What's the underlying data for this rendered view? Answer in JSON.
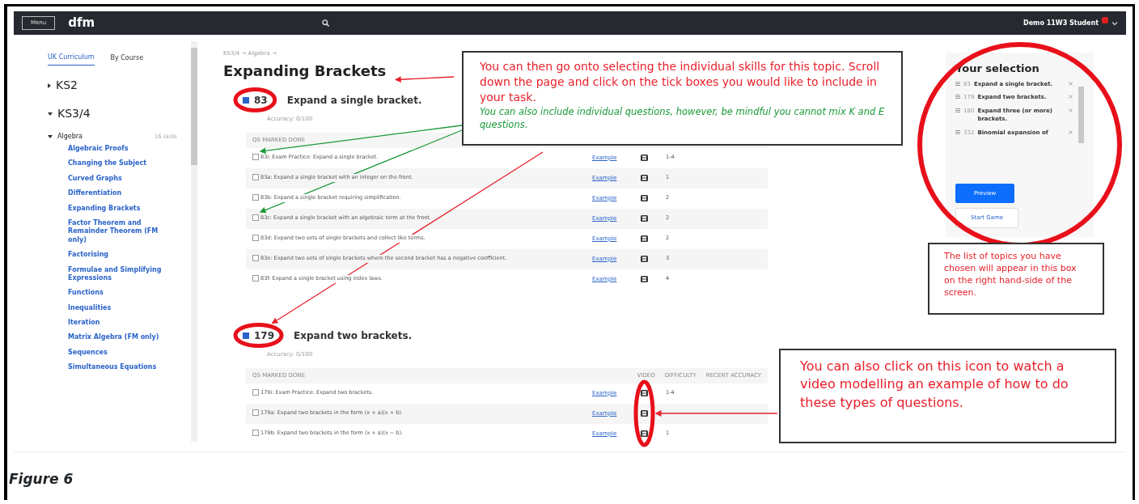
{
  "navbar": {
    "menu_button": "Menu",
    "brand": "dfm",
    "user": "Demo 11W3 Student",
    "has_notification": true
  },
  "sidebar": {
    "tabs": [
      {
        "label": "UK Curriculum",
        "selected": true
      },
      {
        "label": "By Course",
        "selected": false
      }
    ],
    "tree": [
      {
        "label": "KS2",
        "expanded": false
      },
      {
        "label": "KS3/4",
        "expanded": true,
        "children": [
          {
            "label": "Algebra",
            "count": "16 skills",
            "expanded": true,
            "children": [
              {
                "label": "Algebraic Proofs"
              },
              {
                "label": "Changing the Subject"
              },
              {
                "label": "Curved Graphs"
              },
              {
                "label": "Differentiation"
              },
              {
                "label": "Expanding Brackets"
              },
              {
                "label": "Factor Theorem and Remainder Theorem (FM only)"
              },
              {
                "label": "Factorising"
              },
              {
                "label": "Formulae and Simplifying Expressions"
              },
              {
                "label": "Functions"
              },
              {
                "label": "Inequalities"
              },
              {
                "label": "Iteration"
              },
              {
                "label": "Matrix Algebra (FM only)"
              },
              {
                "label": "Sequences"
              },
              {
                "label": "Simultaneous Equations"
              }
            ]
          }
        ]
      }
    ]
  },
  "breadcrumb": "KS3/4 → Algebra →",
  "title": "Expanding Brackets",
  "skills": [
    {
      "number": "83",
      "name": "Expand a single bracket.",
      "selected": true,
      "score": "Accuracy: 0/100",
      "columns": [
        "QS MARKED DONE"
      ],
      "questions": [
        {
          "text": "83i: Exam Practice: Expand a single bracket.",
          "checked": false,
          "link": "Example",
          "difficulty": "1-4"
        },
        {
          "text": "83a: Expand a single bracket with an integer on the front.",
          "checked": false,
          "link": "Example",
          "difficulty": "1"
        },
        {
          "text": "83b: Expand a single bracket requiring simplification.",
          "checked": false,
          "link": "Example",
          "difficulty": "2"
        },
        {
          "text": "83c: Expand a single bracket with an algebraic term at the front.",
          "checked": false,
          "link": "Example",
          "difficulty": "2"
        },
        {
          "text": "83d: Expand two sets of single brackets and collect like terms.",
          "checked": false,
          "link": "Example",
          "difficulty": "2"
        },
        {
          "text": "83e: Expand two sets of single brackets where the second bracket has a negative coefficient.",
          "checked": false,
          "link": "Example",
          "difficulty": "3"
        },
        {
          "text": "83f: Expand a single bracket using index laws.",
          "checked": false,
          "link": "Example",
          "difficulty": "4"
        }
      ]
    },
    {
      "number": "179",
      "name": "Expand two brackets.",
      "selected": true,
      "score": "Accuracy: 0/100",
      "columns": [
        "QS MARKED DONE",
        "VIDEO",
        "DIFFICULTY",
        "RECENT ACCURACY"
      ],
      "questions": [
        {
          "text": "179i: Exam Practice: Expand two brackets.",
          "checked": false,
          "link": "Example",
          "difficulty": "1-4"
        },
        {
          "text": "179a: Expand two brackets in the form (x + a)(x + b).",
          "checked": false,
          "link": "Example"
        },
        {
          "text": "179b: Expand two brackets in the form (x + a)(x − b).",
          "checked": false,
          "link": "Example",
          "difficulty": "1"
        }
      ]
    }
  ],
  "selection": {
    "title": "Your selection",
    "items": [
      {
        "number": "83",
        "name": "Expand a single bracket."
      },
      {
        "number": "179",
        "name": "Expand two brackets."
      },
      {
        "number": "180",
        "name": "Expand three (or more) brackets."
      },
      {
        "number": "332",
        "name": "Binomial expansion of"
      }
    ],
    "buttons": [
      {
        "label": "Preview",
        "kind": "primary"
      },
      {
        "label": "Start Game",
        "kind": "outline"
      }
    ]
  },
  "callouts": [
    {
      "kind": "large",
      "text": "You can then go onto selecting the individual skills for this topic. Scroll down the page and click on the tick boxes you would like to include in your task.",
      "note": "You can also include individual questions, however, be mindful you cannot mix K and E questions."
    },
    {
      "kind": "small",
      "text": "The list of topics you have chosen will appear in this box on the right hand-side of the screen."
    },
    {
      "kind": "medium",
      "text": "You can also click on this icon to watch a video modelling an example of how to do these types of questions."
    }
  ],
  "caption": "Figure 6"
}
